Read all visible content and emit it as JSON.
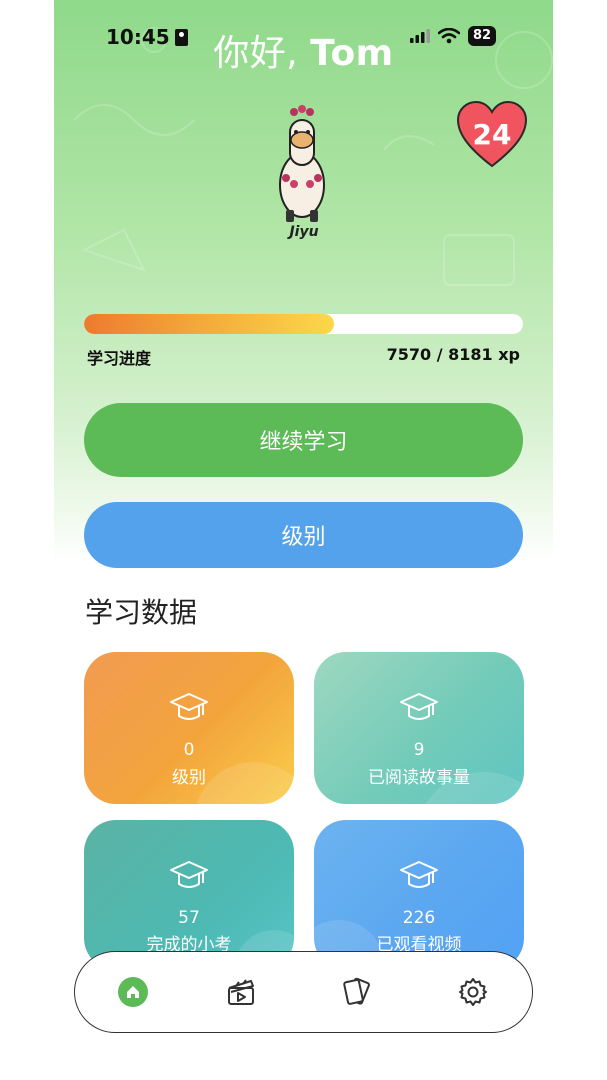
{
  "status_bar": {
    "time": "10:45",
    "battery": "82"
  },
  "greeting": {
    "prefix": "你好, ",
    "name": "Tom"
  },
  "mascot": {
    "name": "Jiyu"
  },
  "heart": {
    "value": "24"
  },
  "progress": {
    "label": "学习进度",
    "value_text": "7570 / 8181 xp",
    "fraction": 0.57
  },
  "buttons": {
    "continue": "继续学习",
    "level": "级别"
  },
  "stats": {
    "title": "学习数据",
    "cards": [
      {
        "value": "0",
        "label": "级别"
      },
      {
        "value": "9",
        "label": "已阅读故事量"
      },
      {
        "value": "57",
        "label": "完成的小考"
      },
      {
        "value": "226",
        "label": "已观看视频"
      }
    ]
  },
  "tabbar": {
    "icons": [
      "home-icon",
      "video-clapper-icon",
      "flashcards-icon",
      "settings-gear-icon"
    ]
  },
  "colors": {
    "green": "#5cba57",
    "blue": "#55a2ec",
    "heart": "#f0545e",
    "orange": "#f3a53c"
  }
}
